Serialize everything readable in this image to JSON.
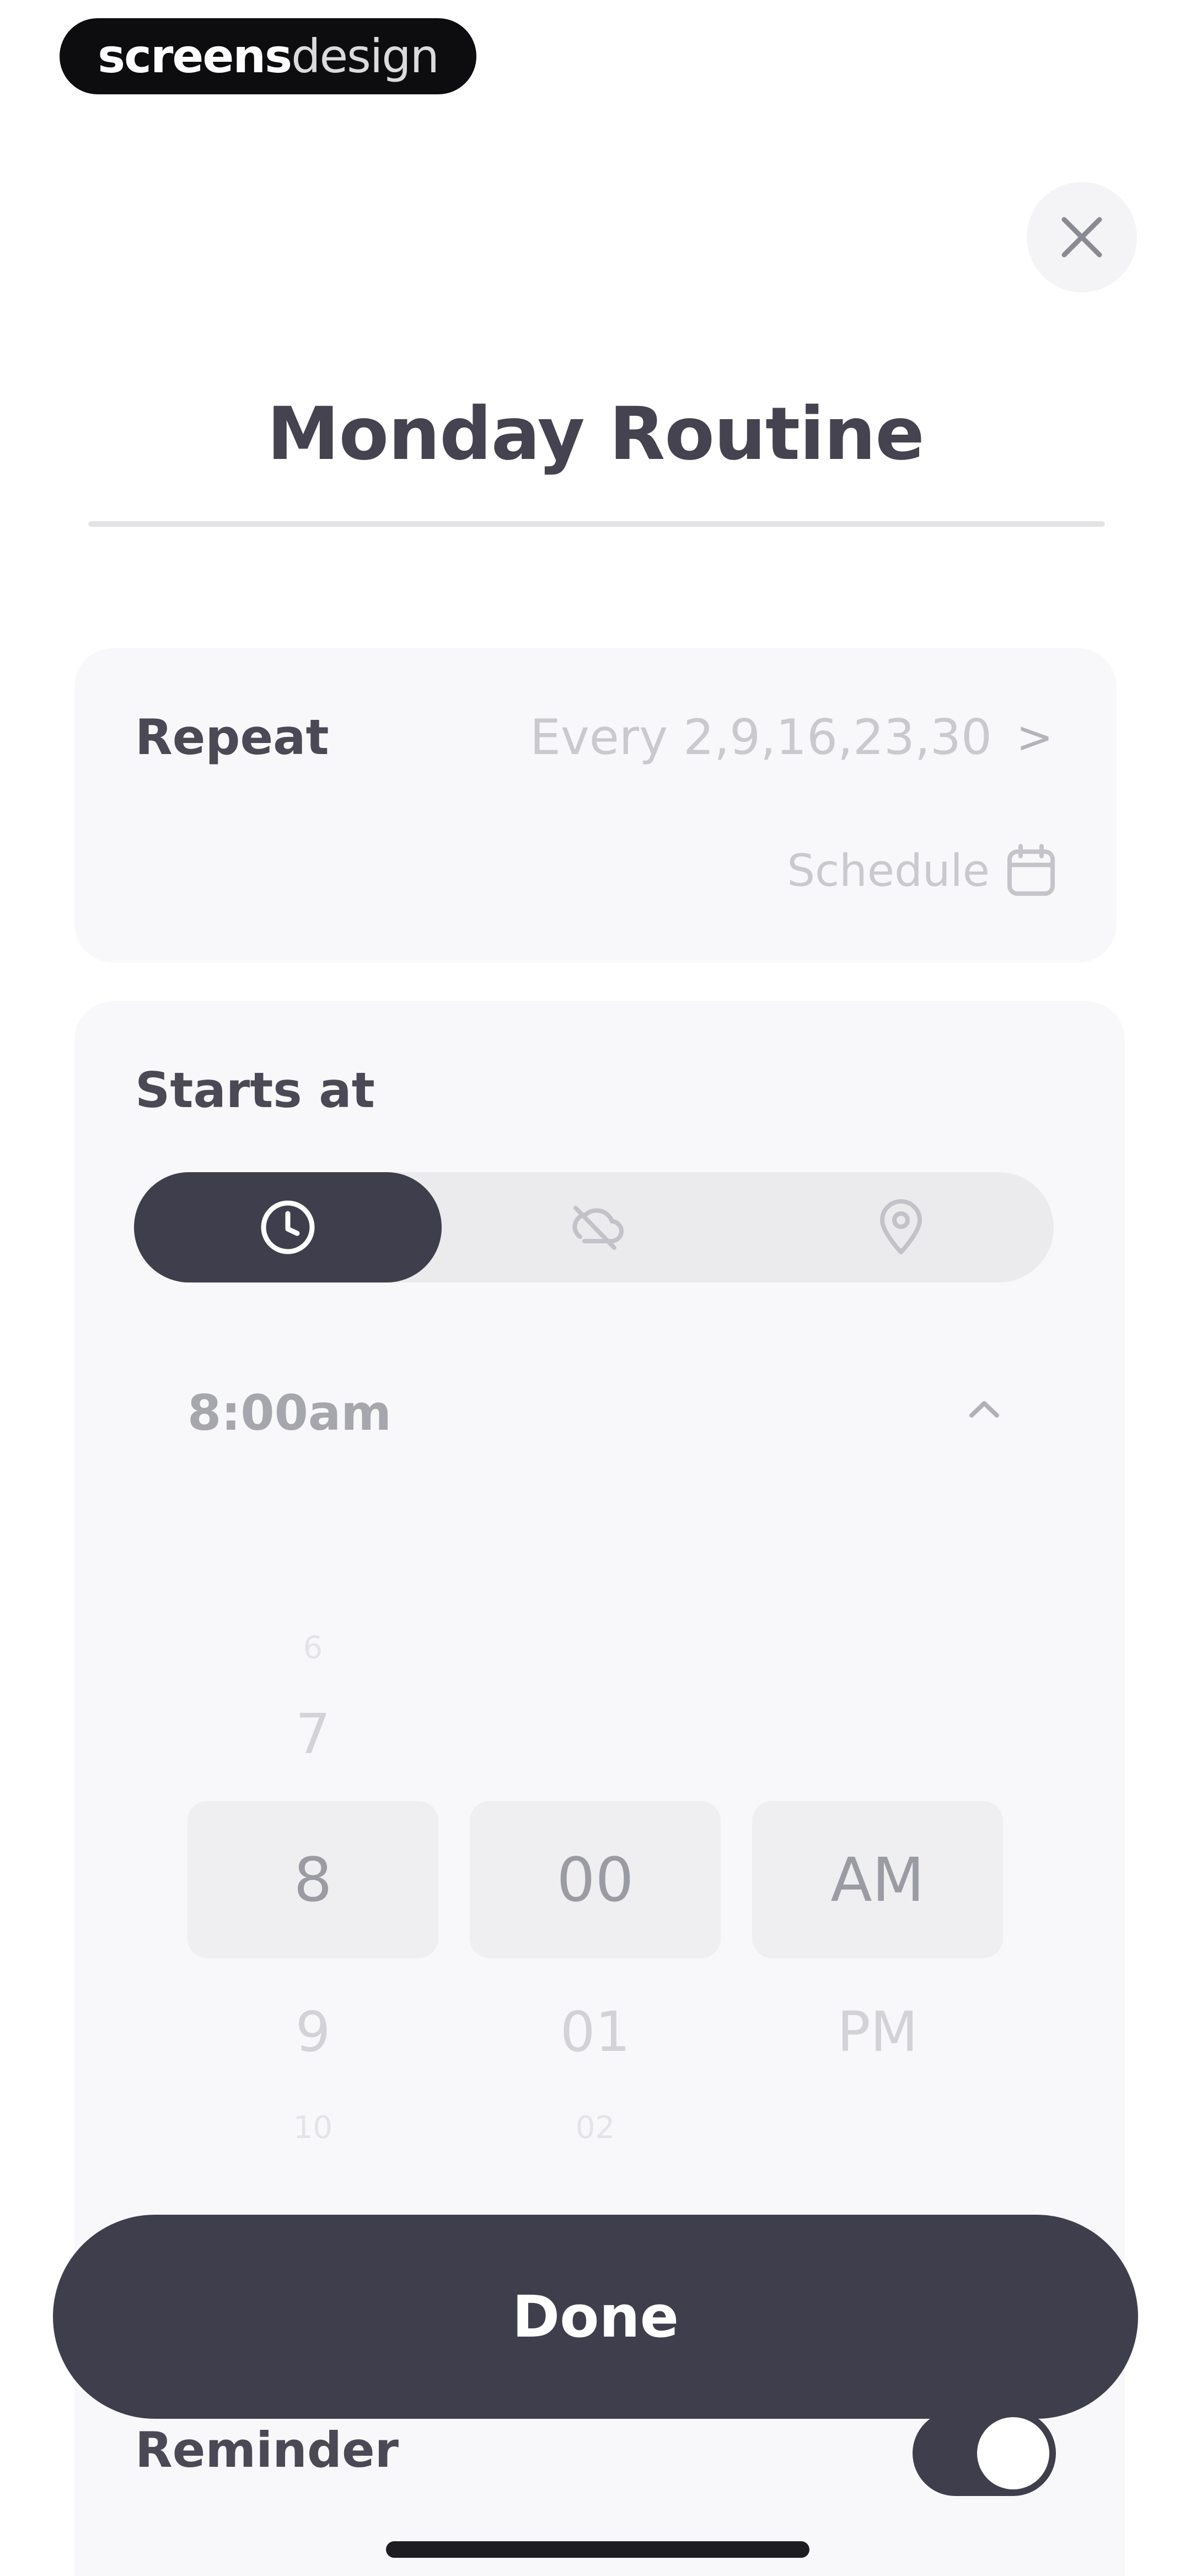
{
  "watermark": {
    "part1": "screens",
    "part2": "design"
  },
  "header": {
    "title": "Monday Routine",
    "close_icon": "close-icon"
  },
  "repeat": {
    "label": "Repeat",
    "value": "Every 2,9,16,23,30",
    "chevron": ">",
    "schedule_label": "Schedule",
    "schedule_icon": "calendar-icon"
  },
  "starts_at": {
    "label": "Starts at",
    "tabs": [
      {
        "icon": "clock-icon",
        "selected": true
      },
      {
        "icon": "weather-off-icon",
        "selected": false
      },
      {
        "icon": "location-pin-icon",
        "selected": false
      }
    ],
    "time_value": "8:00am"
  },
  "picker": {
    "hour": {
      "above_far": "6",
      "above": "7",
      "selected": "8",
      "below": "9",
      "below_far": "10"
    },
    "minute": {
      "selected": "00",
      "below": "01",
      "below_far": "02"
    },
    "period": {
      "selected": "AM",
      "below": "PM"
    }
  },
  "done_button": {
    "label": "Done"
  },
  "reminder": {
    "label": "Reminder",
    "enabled": true
  },
  "colors": {
    "accent_dark": "#3f3e4c",
    "card_bg": "#f8f8fa",
    "muted_text": "#c9c9ce"
  }
}
